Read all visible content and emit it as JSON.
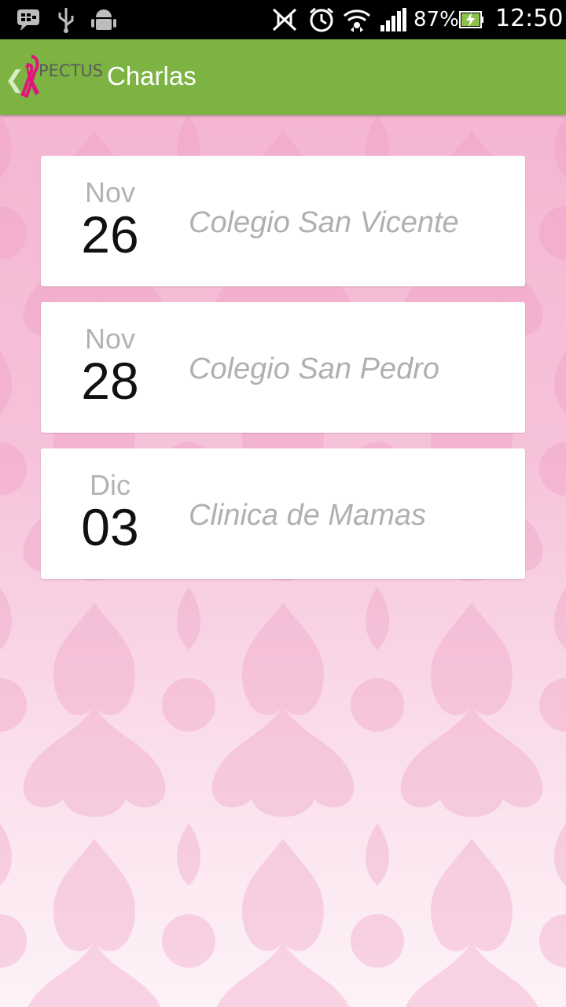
{
  "status_bar": {
    "battery_percent": "87%",
    "time": "12:50",
    "icons": [
      "bbm-icon",
      "usb-icon",
      "android-icon",
      "nfc-icon",
      "alarm-icon",
      "wifi-icon",
      "signal-icon",
      "battery-charging-icon"
    ]
  },
  "action_bar": {
    "logo_text": "PECTUS",
    "title": "Charlas"
  },
  "talks": [
    {
      "month": "Nov",
      "day": "26",
      "place": "Colegio San Vicente"
    },
    {
      "month": "Nov",
      "day": "28",
      "place": "Colegio San Pedro"
    },
    {
      "month": "Dic",
      "day": "03",
      "place": "Clinica de Mamas"
    }
  ],
  "colors": {
    "action_bar": "#7cb342",
    "ribbon": "#e0147a",
    "background": "#f4b2d0"
  }
}
